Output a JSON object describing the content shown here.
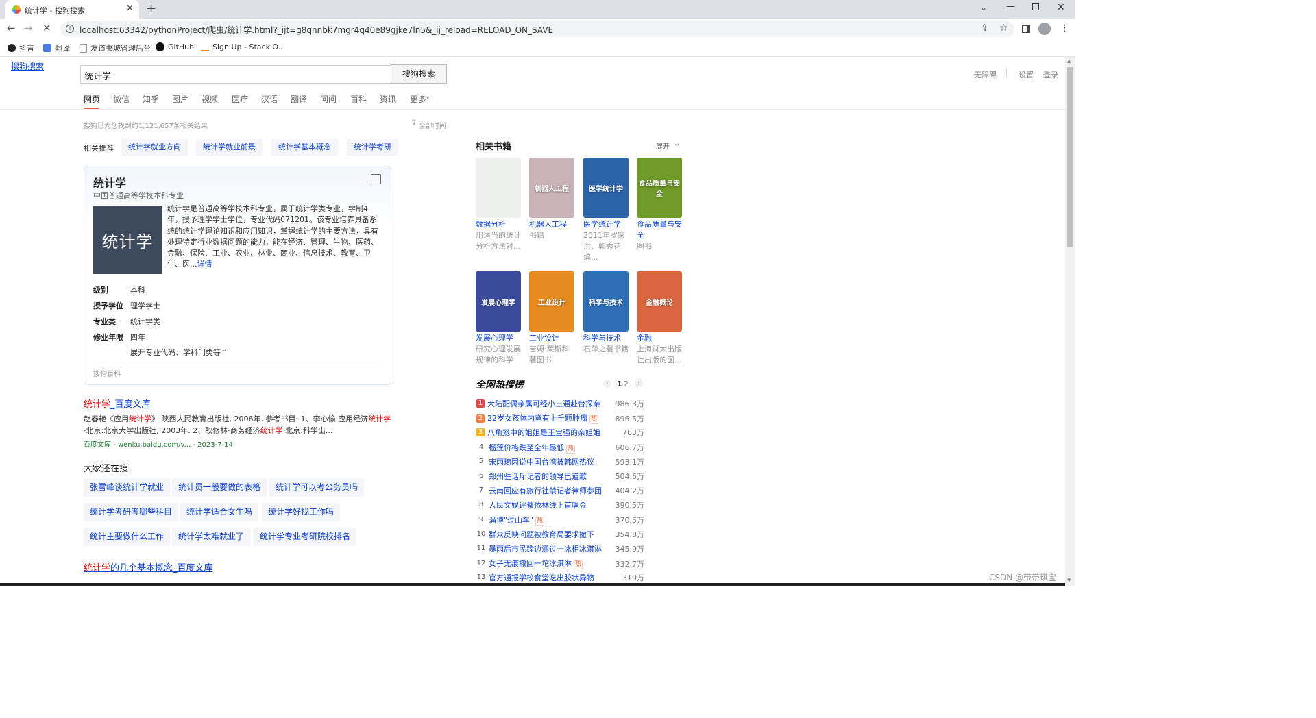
{
  "browser": {
    "tab_title": "统计学 - 搜狗搜索",
    "url": "localhost:63342/pythonProject/爬虫/统计学.html?_ijt=g8qnnbk7mgr4q40e89gjke7ln5&_ij_reload=RELOAD_ON_SAVE",
    "bookmarks": [
      "抖音",
      "翻译",
      "友道书城管理后台",
      "GitHub",
      "Sign Up - Stack O..."
    ]
  },
  "header": {
    "logo_alt": "搜狗搜索",
    "query": "统计学",
    "search_button": "搜狗搜索",
    "right_links": [
      "无障碍",
      "设置",
      "登录"
    ],
    "nav": [
      "网页",
      "微信",
      "知乎",
      "图片",
      "视频",
      "医疗",
      "汉语",
      "翻译",
      "问问",
      "百科",
      "资讯",
      "更多"
    ]
  },
  "results_info": {
    "count_text": "搜狗已为您找到约1,121,657条相关结果",
    "filter": "全部时间"
  },
  "related": {
    "label": "相关推荐",
    "tags": [
      "统计学就业方向",
      "统计学就业前景",
      "统计学基本概念",
      "统计学考研"
    ]
  },
  "baike_card": {
    "title": "统计学",
    "subtitle": "中国普通高等学校本科专业",
    "image_text": "统计学",
    "description": "统计学是普通高等学校本科专业，属于统计学类专业，学制4年，授予理学学士学位，专业代码071201。该专业培养具备系统的统计学理论知识和应用知识，掌握统计学的主要方法，具有处理特定行业数据问题的能力，能在经济、管理、生物、医药、金融、保险、工业、农业、林业、商业、信息技术、教育、卫生、医...",
    "more_link": "详情",
    "rows": [
      {
        "label": "级别",
        "value": "本科"
      },
      {
        "label": "授予学位",
        "value": "理学学士"
      },
      {
        "label": "专业类",
        "value": "统计学类"
      },
      {
        "label": "修业年限",
        "value": "四年"
      }
    ],
    "expand_text": "展开专业代码、学科门类等",
    "source": "搜狗百科"
  },
  "result1": {
    "title_hl": "统计学",
    "title_rest": "_百度文库",
    "snippet_a": "赵春艳《应用",
    "snippet_b": "统计学",
    "snippet_c": "》 陕西人民教育出版社, 2006年. 参考书目: 1、李心愉·应用经济",
    "snippet_d": "统计学",
    "snippet_e": "·北京:北京大学出版社, 2003年. 2、耿修林·商务经济",
    "snippet_f": "统计学",
    "snippet_g": "·北京:科学出...",
    "source": "百度文库 - wenku.baidu.com/v... - 2023-7-14"
  },
  "also_search": {
    "title": "大家还在搜",
    "row1": [
      "张雪峰谈统计学就业",
      "统计员一般要做的表格",
      "统计学可以考公务员吗"
    ],
    "row2": [
      "统计学考研考哪些科目",
      "统计学适合女生吗",
      "统计学好找工作吗"
    ],
    "row3": [
      "统计主要做什么工作",
      "统计学太难就业了",
      "统计学专业考研院校排名"
    ]
  },
  "result2": {
    "title_hl": "统计学",
    "title_rest": "的几个基本概念_百度文库"
  },
  "books": {
    "title": "相关书籍",
    "expand": "展开",
    "items": [
      {
        "title": "数据分析",
        "desc": "用适当的统计分析方法对...",
        "cover_text": "",
        "color": "#eef2ee"
      },
      {
        "title": "机器人工程",
        "desc": "书籍",
        "cover_text": "机器人工程",
        "color": "#c9b3b7"
      },
      {
        "title": "医学统计学",
        "desc": "2011年罗家洪、郭秀花编...",
        "cover_text": "医学统计学",
        "color": "#2b63a8"
      },
      {
        "title": "食品质量与安全",
        "desc": "图书",
        "cover_text": "食品质量与安全",
        "color": "#6e9b2a"
      },
      {
        "title": "发展心理学",
        "desc": "研究心理发展规律的科学",
        "cover_text": "发展心理学",
        "color": "#3b4a9a"
      },
      {
        "title": "工业设计",
        "desc": "吉姆·莱斯科著图书",
        "cover_text": "工业设计",
        "color": "#e58a1f"
      },
      {
        "title": "科学与技术",
        "desc": "石萍之著书籍",
        "cover_text": "科学与技术",
        "color": "#2d6fb6"
      },
      {
        "title": "金融",
        "desc": "上海财大出版社出版的图...",
        "cover_text": "金融概论",
        "color": "#d9663f"
      }
    ]
  },
  "hot": {
    "title": "全网热搜榜",
    "pages": [
      "1",
      "2"
    ],
    "hot_badge": "热",
    "items": [
      {
        "rank": "1",
        "text": "大陆配偶亲属可经小三通赴台探亲",
        "count": "986.3万",
        "hot": false
      },
      {
        "rank": "2",
        "text": "22岁女孩体内竟有上千颗肿瘤",
        "count": "896.5万",
        "hot": true
      },
      {
        "rank": "3",
        "text": "八角笼中的姐姐是王宝强的亲姐姐",
        "count": "763万",
        "hot": false
      },
      {
        "rank": "4",
        "text": "榴莲价格跌至全年最低",
        "count": "606.7万",
        "hot": true
      },
      {
        "rank": "5",
        "text": "宋雨琦因说中国台湾被韩网热议",
        "count": "593.1万",
        "hot": false
      },
      {
        "rank": "6",
        "text": "郑州驻话斥记者的领导已道歉",
        "count": "504.6万",
        "hot": false
      },
      {
        "rank": "7",
        "text": "云南回应有旅行社禁记者律师参团",
        "count": "404.2万",
        "hot": false
      },
      {
        "rank": "8",
        "text": "人民文娱评蔡依林线上首唱会",
        "count": "390.5万",
        "hot": false
      },
      {
        "rank": "9",
        "text": "淄博\"过山车\"",
        "count": "370.5万",
        "hot": true
      },
      {
        "rank": "10",
        "text": "群众反映问题被教育局要求撤下",
        "count": "354.8万",
        "hot": false
      },
      {
        "rank": "11",
        "text": "暴雨后市民蹚边漂过一冰柜冰淇淋",
        "count": "345.9万",
        "hot": false
      },
      {
        "rank": "12",
        "text": "女子无痕撤回一坨冰淇淋",
        "count": "332.7万",
        "hot": true
      },
      {
        "rank": "13",
        "text": "官方通报学校食堂吃出胶状异物",
        "count": "319万",
        "hot": false
      }
    ]
  },
  "watermark": "CSDN @带带琪宝",
  "colors": {
    "accent": "#0c44d3",
    "highlight": "#e10601",
    "nav_active": "#e85d3c"
  }
}
